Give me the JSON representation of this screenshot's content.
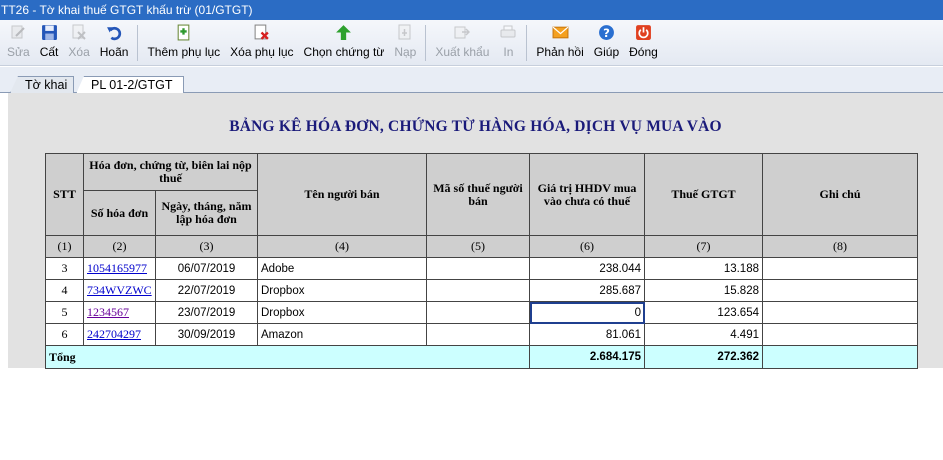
{
  "window": {
    "title": "TT26 - Tờ khai thuế GTGT khấu trừ (01/GTGT)"
  },
  "toolbar": {
    "buttons": [
      {
        "id": "sua",
        "label": "Sửa",
        "icon": "edit-icon",
        "enabled": false
      },
      {
        "id": "cat",
        "label": "Cất",
        "icon": "floppy-disk-icon",
        "enabled": true
      },
      {
        "id": "xoa",
        "label": "Xóa",
        "icon": "delete-document-icon",
        "enabled": false
      },
      {
        "id": "hoan",
        "label": "Hoãn",
        "icon": "undo-icon",
        "enabled": true
      },
      {
        "id": "them_phu_luc",
        "label": "Thêm phụ lục",
        "icon": "add-appendix-icon",
        "enabled": true
      },
      {
        "id": "xoa_phu_luc",
        "label": "Xóa phụ lục",
        "icon": "remove-appendix-icon",
        "enabled": true
      },
      {
        "id": "chon_chung_tu",
        "label": "Chọn chứng từ",
        "icon": "up-arrow-icon",
        "enabled": true
      },
      {
        "id": "nap",
        "label": "Nạp",
        "icon": "load-icon",
        "enabled": false
      },
      {
        "id": "xuat_khau",
        "label": "Xuất khẩu",
        "icon": "export-icon",
        "enabled": false
      },
      {
        "id": "in",
        "label": "In",
        "icon": "print-icon",
        "enabled": false
      },
      {
        "id": "phan_hoi",
        "label": "Phản hồi",
        "icon": "envelope-icon",
        "enabled": true
      },
      {
        "id": "giup",
        "label": "Giúp",
        "icon": "help-icon",
        "enabled": true
      },
      {
        "id": "dong",
        "label": "Đóng",
        "icon": "power-icon",
        "enabled": true
      }
    ]
  },
  "tabs": [
    {
      "label": "Tờ khai",
      "active": false
    },
    {
      "label": "PL 01-2/GTGT",
      "active": true
    }
  ],
  "report": {
    "title": "BẢNG KÊ HÓA ĐƠN, CHỨNG TỪ HÀNG HÓA, DỊCH VỤ MUA VÀO",
    "headers": {
      "stt": "STT",
      "group": "Hóa đơn, chứng từ, biên lai nộp thuế",
      "so_hoa_don": "Số hóa đơn",
      "ngay": "Ngày, tháng, năm lập hóa đơn",
      "ten_nguoi_ban": "Tên người bán",
      "ma_so_thue": "Mã số thuế người bán",
      "gia_tri": "Giá trị HHDV mua vào chưa có thuế",
      "thue": "Thuế GTGT",
      "ghi_chu": "Ghi chú"
    },
    "column_numbers": [
      "(1)",
      "(2)",
      "(3)",
      "(4)",
      "(5)",
      "(6)",
      "(7)",
      "(8)"
    ],
    "rows": [
      {
        "stt": "3",
        "so_hoa_don": "1054165977",
        "ngay": "06/07/2019",
        "ten": "Adobe",
        "mst": "",
        "gia_tri": "238.044",
        "thue": "13.188",
        "ghi_chu": ""
      },
      {
        "stt": "4",
        "so_hoa_don": "734WVZWC",
        "ngay": "22/07/2019",
        "ten": "Dropbox",
        "mst": "",
        "gia_tri": "285.687",
        "thue": "15.828",
        "ghi_chu": ""
      },
      {
        "stt": "5",
        "so_hoa_don": "1234567",
        "ngay": "23/07/2019",
        "ten": "Dropbox",
        "mst": "",
        "gia_tri": "0",
        "thue": "123.654",
        "ghi_chu": ""
      },
      {
        "stt": "6",
        "so_hoa_don": "242704297",
        "ngay": "30/09/2019",
        "ten": "Amazon",
        "mst": "",
        "gia_tri": "81.061",
        "thue": "4.491",
        "ghi_chu": ""
      }
    ],
    "total": {
      "label": "Tổng",
      "gia_tri": "2.684.175",
      "thue": "272.362"
    }
  }
}
